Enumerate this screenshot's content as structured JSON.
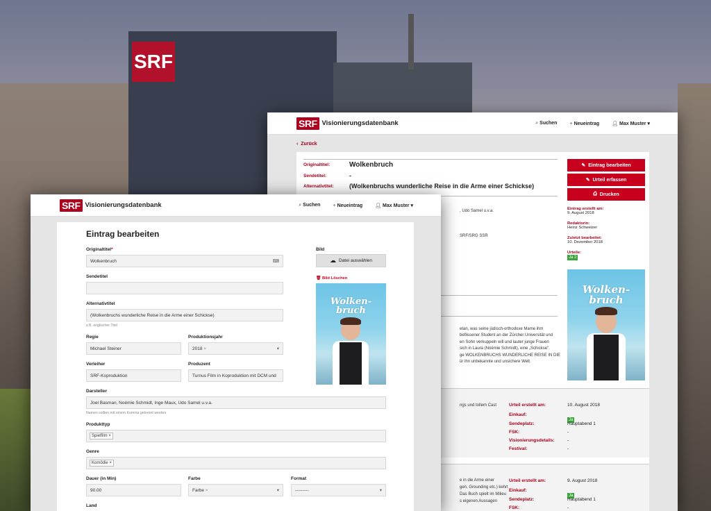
{
  "background_sign": "SRF",
  "back_window": {
    "logo": "SRF",
    "app_title": "Visionierungsdatenbank",
    "nav": {
      "search": "Suchen",
      "new_entry": "Neueintrag",
      "user": "Max Muster"
    },
    "back_link": "Zurück",
    "fields": [
      {
        "label": "Originaltitel:",
        "value": "Wolkenbruch"
      },
      {
        "label": "Sendetitel:",
        "value": "-"
      },
      {
        "label": "Alternativtitel:",
        "value": "(Wolkenbruchs wunderliche Reise in die Arme einer Schickse)"
      }
    ],
    "actions": {
      "edit": "Eintrag bearbeiten",
      "review": "Urteil erfassen",
      "print": "Drucken"
    },
    "meta": [
      {
        "label": "Eintrag erstellt am:",
        "value": "9. August 2018"
      },
      {
        "label": "Redaktorin:",
        "value": "Heinz Schweizer"
      },
      {
        "label": "Zuletzt bearbeitet:",
        "value": "10. Dezember 2018"
      }
    ],
    "verdicts_label": "Urteile:",
    "verdicts_value": "Ja 2",
    "partial_cast": ", Udo Samel u.v.a.",
    "partial_producer": "SRF/SRG SSR",
    "synopsis": [
      "etan, was seine jüdisch-orthodoxe Mame ihm",
      "beflissener Student an der Zürcher Universität und",
      "en Sohn verkuppeln will und lauter junge Frauen",
      "sich in Laura (Noémie Schmidt), eine „Schickse\".",
      "ge WOLKENBRUCHS WUNDERLICHE REISE IN DIE",
      "ür ihn unbekannte und unsichere Welt."
    ],
    "review1": {
      "partial_text": "ngs und tollem Cast",
      "rows": [
        {
          "label": "Urteil erstellt am:",
          "value": "10. August 2018"
        },
        {
          "label": "Einkauf:",
          "value": "Ja"
        },
        {
          "label": "Sendeplatz:",
          "value": "Hauptabend 1"
        },
        {
          "label": "FSK:",
          "value": "-"
        },
        {
          "label": "Visionierungsdetails:",
          "value": "-"
        },
        {
          "label": "Festival:",
          "value": "-"
        }
      ]
    },
    "review2": {
      "partial_text": [
        "e in die Arme einer",
        "gen, Grounding etc.) kehrt",
        "Das Buch spielt im Milieu",
        "s eigenen Aussagen"
      ],
      "rows": [
        {
          "label": "Urteil erstellt am:",
          "value": "9. August 2018"
        },
        {
          "label": "Einkauf:",
          "value": "Ja"
        },
        {
          "label": "Sendeplatz:",
          "value": "Hauptabend 1"
        },
        {
          "label": "FSK:",
          "value": "-"
        }
      ]
    }
  },
  "front_window": {
    "logo": "SRF",
    "app_title": "Visionierungsdatenbank",
    "nav": {
      "search": "Suchen",
      "new_entry": "Neueintrag",
      "user": "Max Muster"
    },
    "heading": "Eintrag bearbeiten",
    "originaltitel": {
      "label": "Originaltitel",
      "required": "*",
      "value": "Wolkenbruch"
    },
    "sendetitel": {
      "label": "Sendetitel",
      "value": ""
    },
    "alternativtitel": {
      "label": "Alternativtitel",
      "value": "(Wolkenbruchs wunderliche Reise in die Arme einer Schickse)",
      "help": "z.B. englischer Titel"
    },
    "regie": {
      "label": "Regie",
      "value": "Michael Steiner"
    },
    "produktionsjahr": {
      "label": "Produktionsjahr",
      "value": "2018"
    },
    "verleiher": {
      "label": "Verleiher",
      "value": "SRF-Koproduktion"
    },
    "produzent": {
      "label": "Produzent",
      "value": "Turnus Film in Koproduktion mit DCM und"
    },
    "darsteller": {
      "label": "Darsteller",
      "value": "Joel Basman, Noémie Schmidt, Inge Maux, Udo Samel u.v.a.",
      "help": "Namen sollten mit einem Komma getrennt werden"
    },
    "produkttyp": {
      "label": "Produkttyp",
      "value": "Spielfilm"
    },
    "genre": {
      "label": "Genre",
      "value": "Komödie"
    },
    "dauer": {
      "label": "Dauer (in Min)",
      "value": "90.00"
    },
    "farbe": {
      "label": "Farbe",
      "value": "Farbe"
    },
    "format": {
      "label": "Format",
      "value": "---------"
    },
    "land": {
      "label": "Land"
    },
    "bild": {
      "label": "Bild",
      "button": "Datei auswählen",
      "delete": "Bild Löschen"
    }
  },
  "poster_title": "Wolken-bruch",
  "colors": {
    "srf_red": "#af001d",
    "action_red": "#c8001e",
    "green": "#3aa53a"
  }
}
